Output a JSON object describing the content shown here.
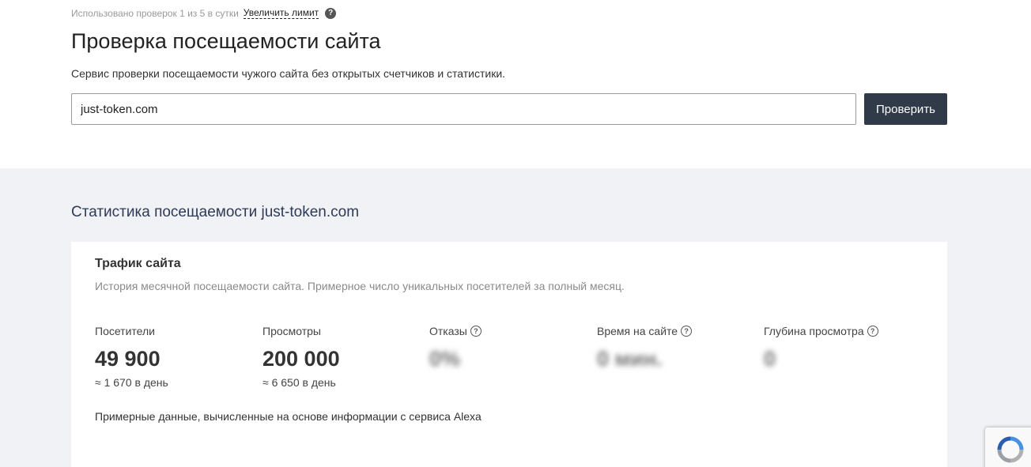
{
  "limit": {
    "usage_text": "Использовано проверок 1 из 5 в сутки",
    "increase_link": "Увеличить лимит",
    "help_glyph": "?"
  },
  "header": {
    "title": "Проверка посещаемости сайта",
    "subtitle": "Сервис проверки посещаемости чужого сайта без открытых счетчиков и статистики."
  },
  "search": {
    "value": "just-token.com",
    "button_label": "Проверить"
  },
  "stats": {
    "heading": "Статистика посещаемости just-token.com",
    "card": {
      "title": "Трафик сайта",
      "description": "История месячной посещаемости сайта. Примерное число уникальных посетителей за полный месяц.",
      "metrics": [
        {
          "label": "Посетители",
          "value": "49 900",
          "sub": "≈ 1 670 в день"
        },
        {
          "label": "Просмотры",
          "value": "200 000",
          "sub": "≈ 6 650 в день"
        },
        {
          "label": "Отказы",
          "value": "0%",
          "help": "?"
        },
        {
          "label": "Время на сайте",
          "value": "0 мин.",
          "help": "?"
        },
        {
          "label": "Глубина просмотра",
          "value": "0",
          "help": "?"
        }
      ],
      "note": "Примерные данные, вычисленные на основе информации с сервиса Alexa"
    }
  },
  "colors": {
    "button_bg": "#303a48",
    "stats_bg": "#f0f2f5",
    "heading_color": "#2f3a55"
  }
}
